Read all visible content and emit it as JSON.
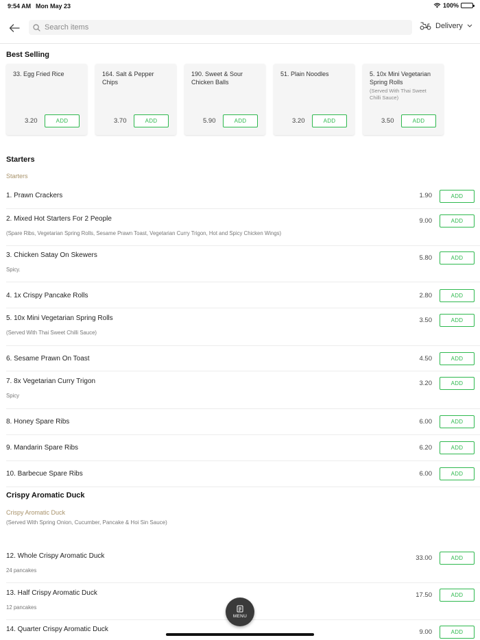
{
  "status_bar": {
    "time": "9:54 AM",
    "date": "Mon May 23",
    "battery": "100%"
  },
  "header": {
    "search_placeholder": "Search items",
    "delivery_label": "Delivery"
  },
  "best_selling": {
    "title": "Best Selling",
    "items": [
      {
        "name": "33. Egg Fried Rice",
        "sub": "",
        "price": "3.20",
        "add": "ADD"
      },
      {
        "name": "164. Salt & Pepper Chips",
        "sub": "",
        "price": "3.70",
        "add": "ADD"
      },
      {
        "name": "190. Sweet & Sour Chicken Balls",
        "sub": "",
        "price": "5.90",
        "add": "ADD"
      },
      {
        "name": "51. Plain Noodles",
        "sub": "",
        "price": "3.20",
        "add": "ADD"
      },
      {
        "name": "5. 10x Mini Vegetarian Spring Rolls",
        "sub": "(Served With Thai Sweet Chilli Sauce)",
        "price": "3.50",
        "add": "ADD"
      }
    ]
  },
  "starters": {
    "title": "Starters",
    "subtitle": "Starters",
    "items": [
      {
        "name": "1. Prawn Crackers",
        "desc": "",
        "price": "1.90",
        "add": "ADD"
      },
      {
        "name": "2. Mixed Hot Starters For 2 People",
        "desc": "(Spare Ribs, Vegetarian Spring Rolls, Sesame Prawn Toast, Vegetarian Curry Trigon, Hot and Spicy Chicken Wings)",
        "price": "9.00",
        "add": "ADD"
      },
      {
        "name": "3. Chicken Satay On Skewers",
        "desc": "Spicy.",
        "price": "5.80",
        "add": "ADD"
      },
      {
        "name": "4. 1x Crispy Pancake Rolls",
        "desc": "",
        "price": "2.80",
        "add": "ADD"
      },
      {
        "name": "5. 10x Mini Vegetarian Spring Rolls",
        "desc": "(Served With Thai Sweet Chilli Sauce)",
        "price": "3.50",
        "add": "ADD"
      },
      {
        "name": "6. Sesame Prawn On Toast",
        "desc": "",
        "price": "4.50",
        "add": "ADD"
      },
      {
        "name": "7. 8x Vegetarian Curry Trigon",
        "desc": "Spicy",
        "price": "3.20",
        "add": "ADD"
      },
      {
        "name": "8. Honey Spare Ribs",
        "desc": "",
        "price": "6.00",
        "add": "ADD"
      },
      {
        "name": "9. Mandarin Spare Ribs",
        "desc": "",
        "price": "6.20",
        "add": "ADD"
      },
      {
        "name": "10. Barbecue Spare Ribs",
        "desc": "",
        "price": "6.00",
        "add": "ADD"
      }
    ]
  },
  "duck": {
    "title": "Crispy Aromatic Duck",
    "subtitle": "Crispy Aromatic Duck",
    "description": "(Served With Spring Onion, Cucumber, Pancake & Hoi Sin Sauce)",
    "items": [
      {
        "name": "12. Whole Crispy Aromatic Duck",
        "desc": "24 pancakes",
        "price": "33.00",
        "add": "ADD"
      },
      {
        "name": "13. Half Crispy Aromatic Duck",
        "desc": "12 pancakes",
        "price": "17.50",
        "add": "ADD"
      },
      {
        "name": "14. Quarter Crispy Aromatic Duck",
        "desc": "",
        "price": "9.00",
        "add": "ADD"
      }
    ]
  },
  "menu_button": {
    "label": "MENU"
  },
  "colors": {
    "accent": "#2db84d",
    "category_subtitle": "#a8926a",
    "fab": "#3a3a3a"
  }
}
